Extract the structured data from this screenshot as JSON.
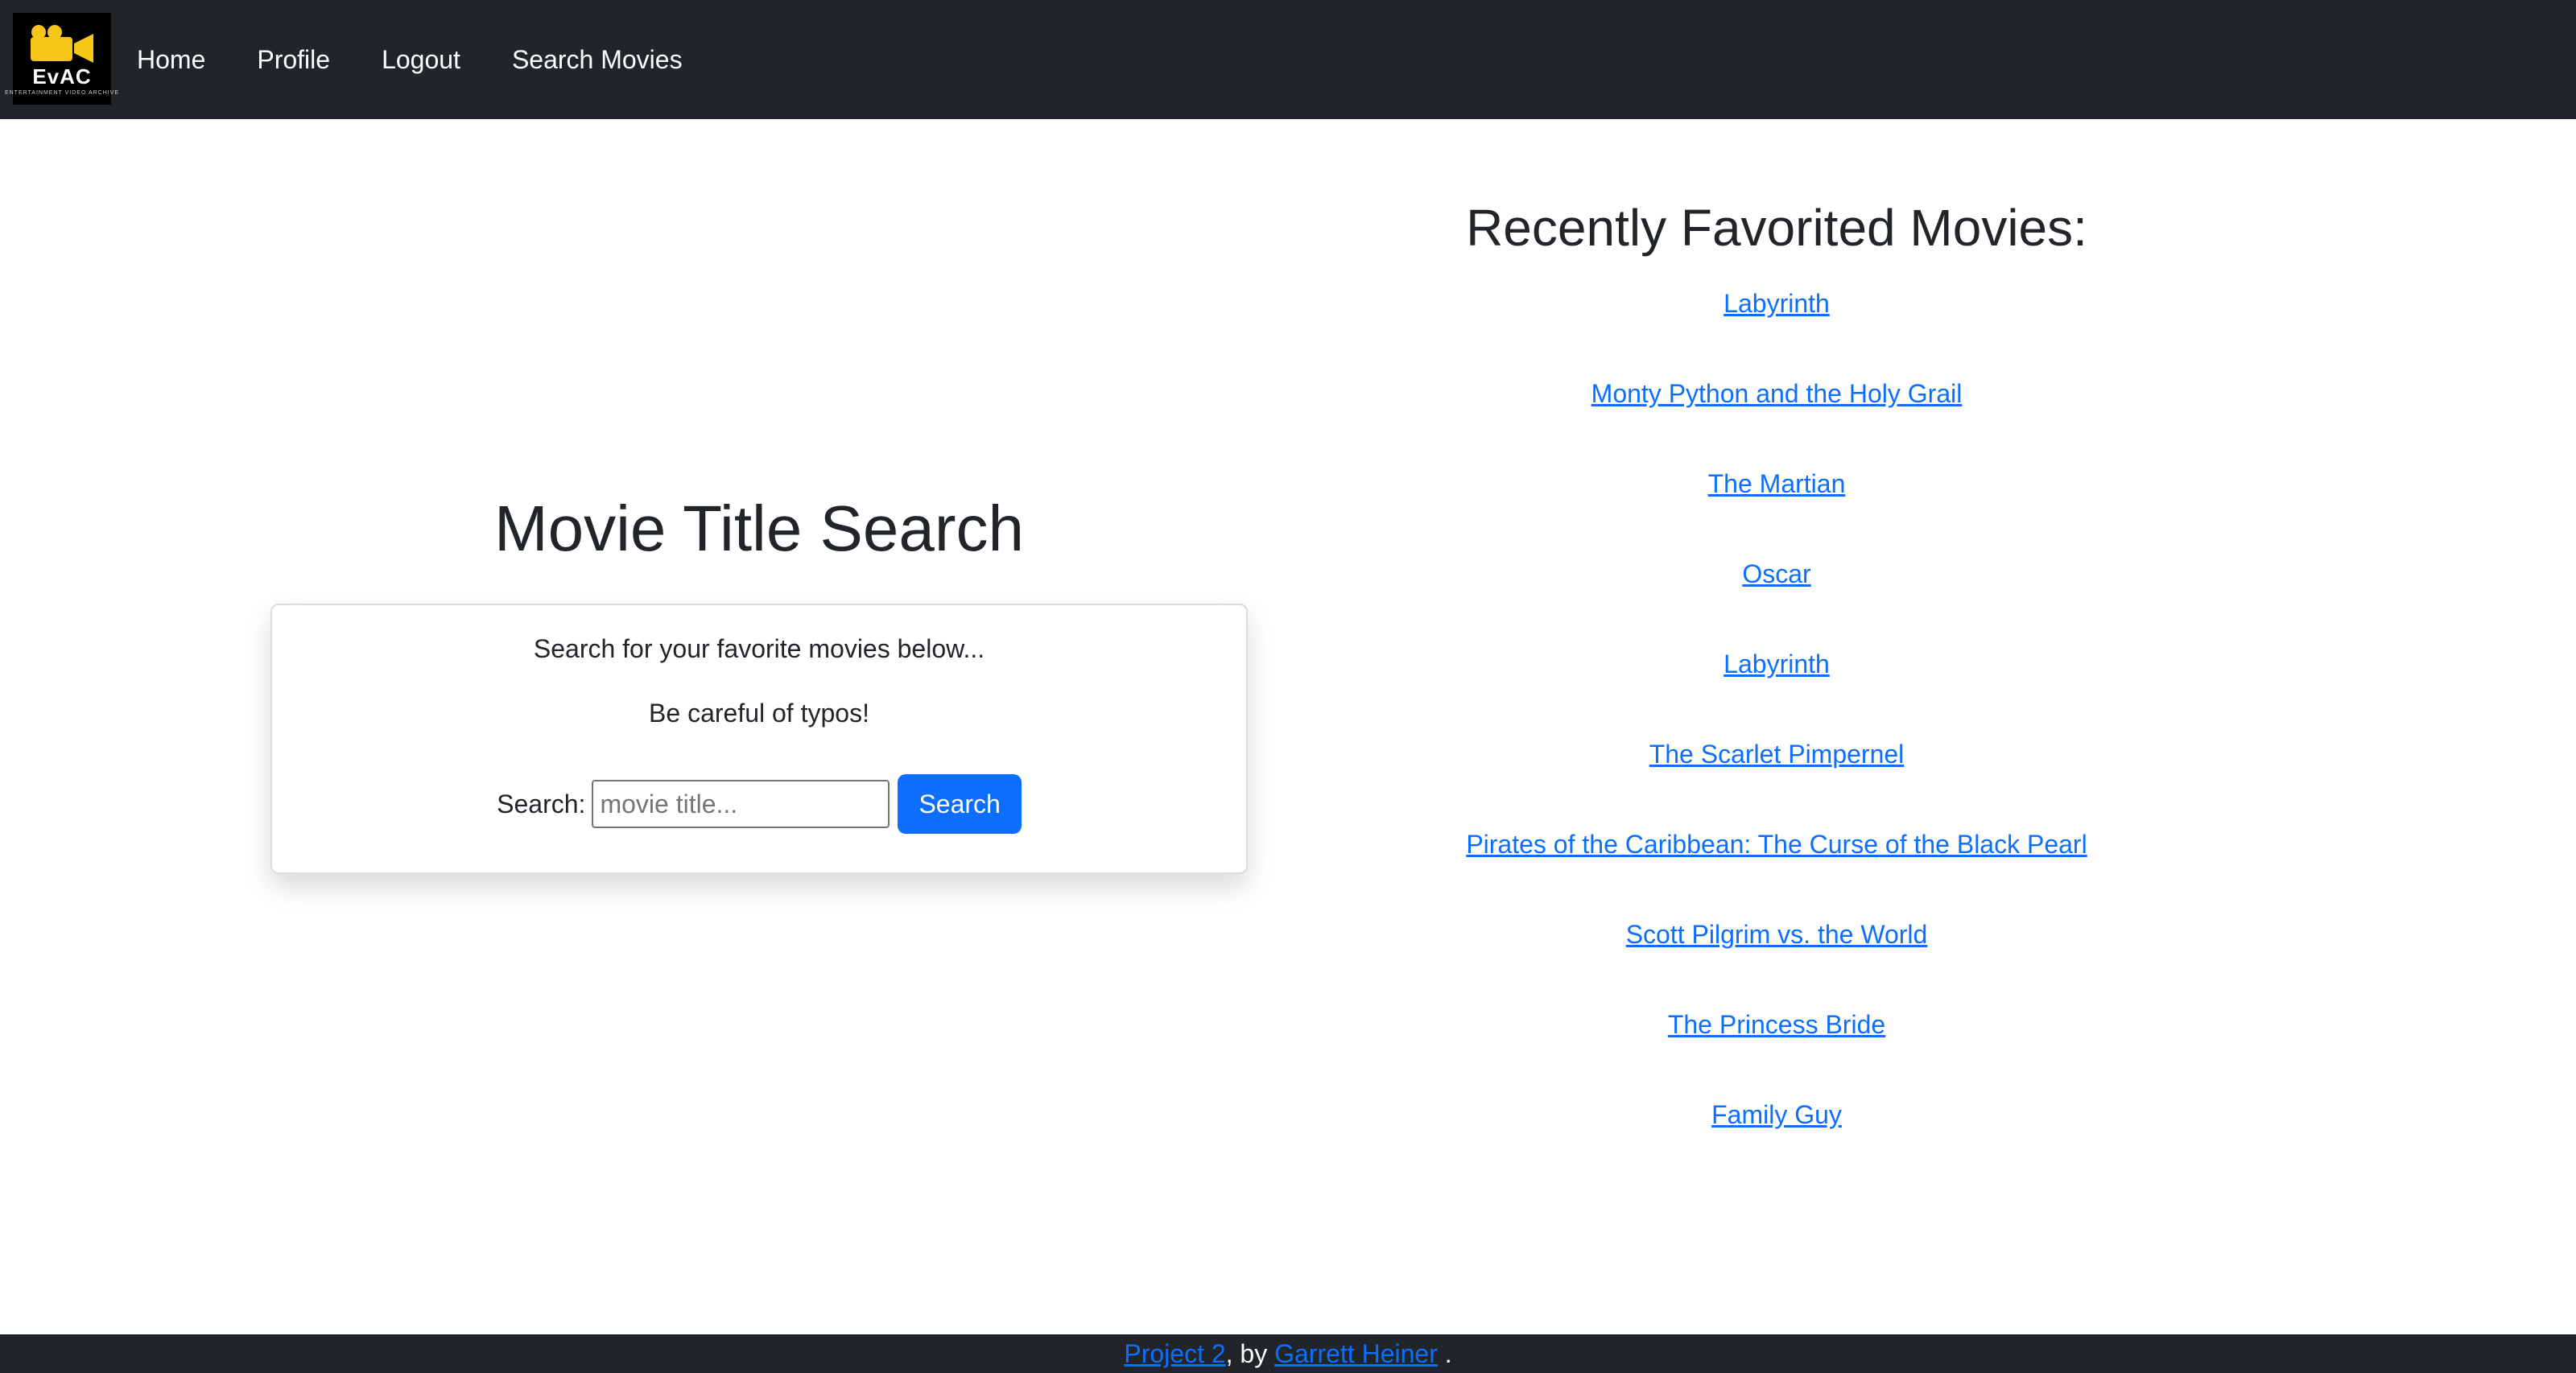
{
  "navbar": {
    "logo": {
      "text": "EvAC",
      "tagline": "ENTERTAINMENT VIDEO ARCHIVE",
      "camera_color": "#f5c518"
    },
    "links": [
      "Home",
      "Profile",
      "Logout",
      "Search Movies"
    ]
  },
  "search": {
    "title": "Movie Title Search",
    "line1": "Search for your favorite movies below...",
    "line2": "Be careful of typos!",
    "label": "Search:",
    "placeholder": "movie title...",
    "button_label": "Search",
    "accent_color": "#0d6efd"
  },
  "favorites": {
    "title": "Recently Favorited Movies:",
    "movies": [
      "Labyrinth",
      "Monty Python and the Holy Grail",
      "The Martian",
      "Oscar",
      "Labyrinth",
      "The Scarlet Pimpernel",
      "Pirates of the Caribbean: The Curse of the Black Pearl",
      "Scott Pilgrim vs. the World",
      "The Princess Bride",
      "Family Guy"
    ]
  },
  "footer": {
    "project_link": "Project 2",
    "by_text": ", by",
    "author_link": "Garrett Heiner",
    "end_text": "."
  },
  "colors": {
    "navbar_bg": "#212529",
    "link": "#0d6efd",
    "text": "#212529"
  }
}
